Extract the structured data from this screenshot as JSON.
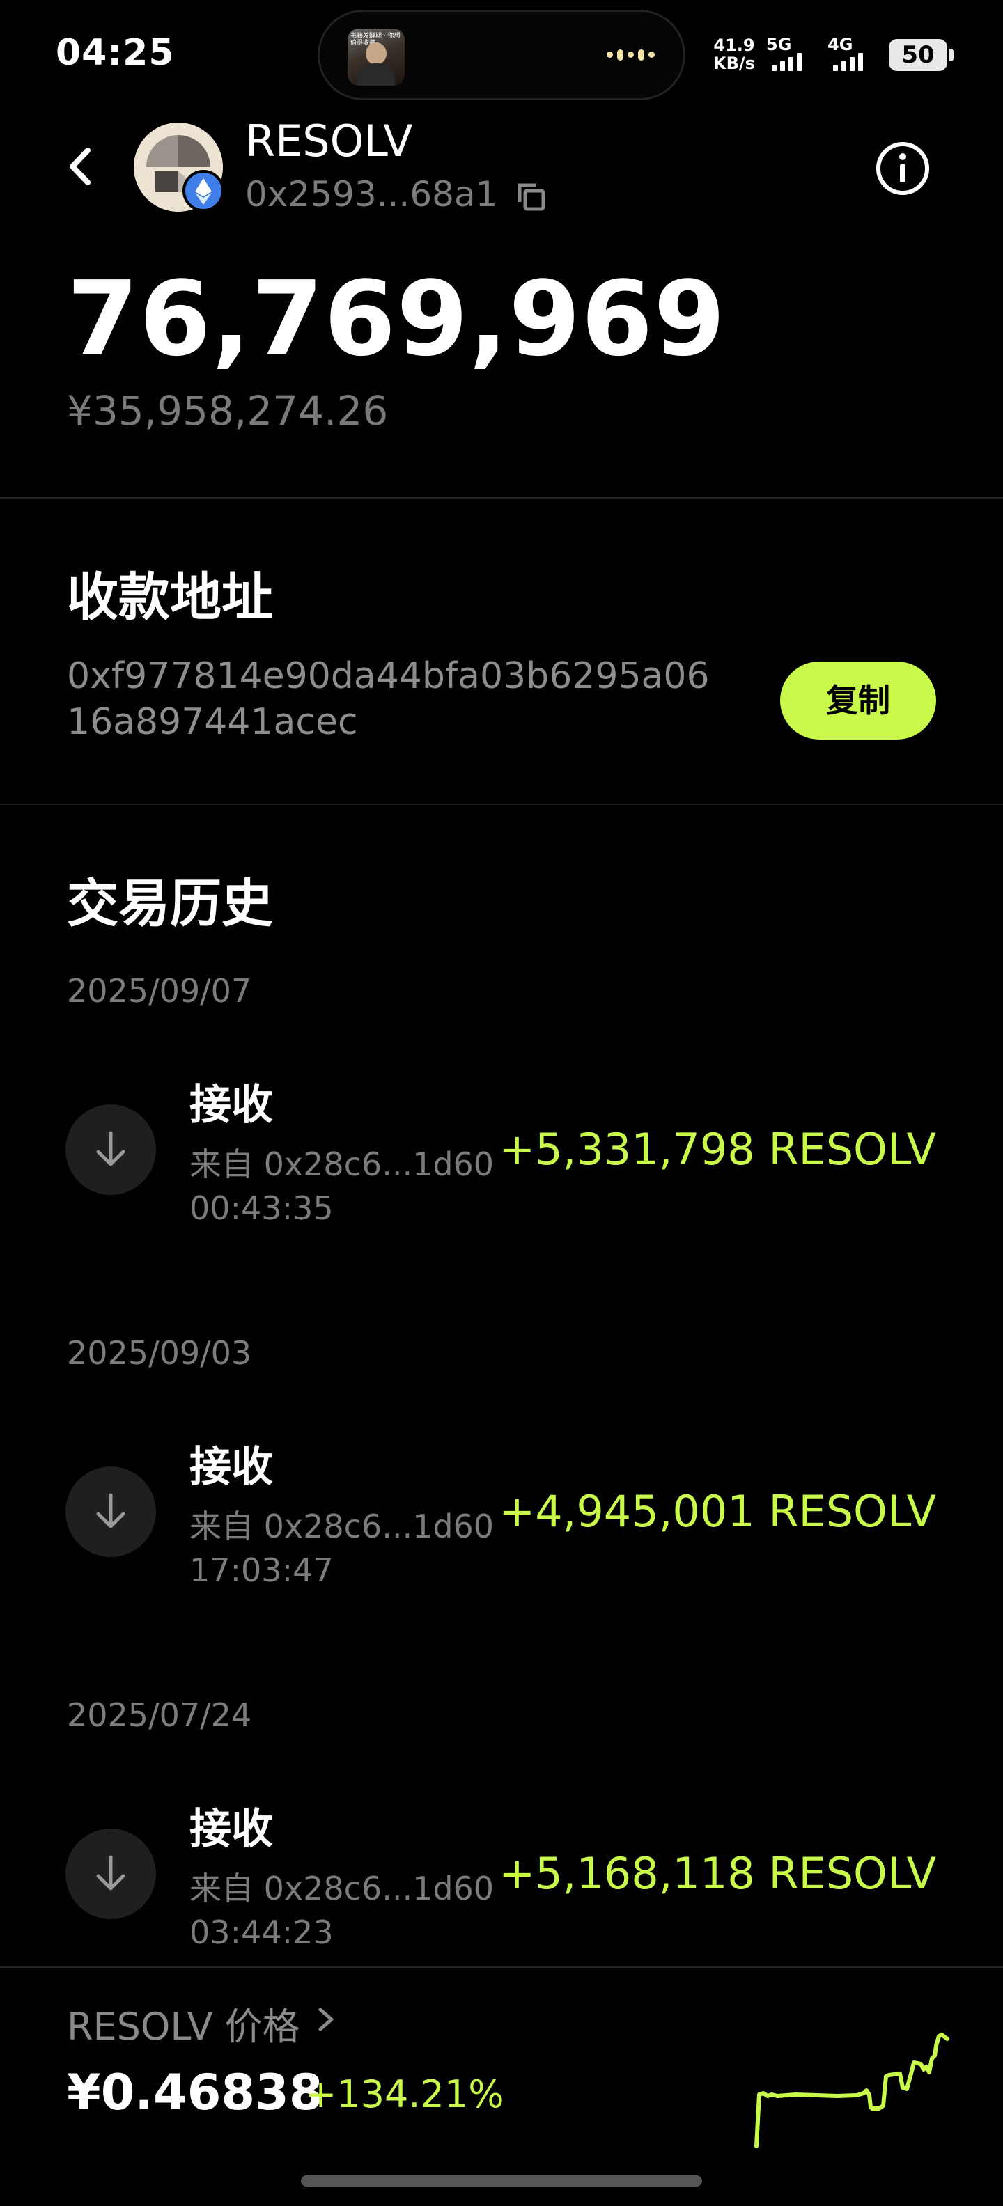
{
  "status_bar": {
    "time": "04:25",
    "net_speed_value": "41.9",
    "net_speed_unit": "KB/s",
    "signal_1_label": "5G",
    "signal_2_label": "4G",
    "battery": "50",
    "island_caption": "书籍发酵期 · 你想值得收藏"
  },
  "header": {
    "token_name": "RESOLV",
    "contract_address": "0x2593...68a1",
    "network_icon": "ethereum-icon"
  },
  "balance": {
    "amount": "76,769,969",
    "fiat_value": "¥35,958,274.26"
  },
  "receive": {
    "title": "收款地址",
    "address": "0xf977814e90da44bfa03b6295a0616a897441acec",
    "copy_label": "复制"
  },
  "history": {
    "title": "交易历史",
    "transactions": [
      {
        "date": "2025/09/07",
        "type": "接收",
        "from": "来自 0x28c6...1d60",
        "time": "00:43:35",
        "amount": "+5,331,798 RESOLV"
      },
      {
        "date": "2025/09/03",
        "type": "接收",
        "from": "来自 0x28c6...1d60",
        "time": "17:03:47",
        "amount": "+4,945,001 RESOLV"
      },
      {
        "date": "2025/07/24",
        "type": "接收",
        "from": "来自 0x28c6...1d60",
        "time": "03:44:23",
        "amount": "+5,168,118 RESOLV"
      }
    ]
  },
  "price": {
    "label": "RESOLV 价格",
    "value": "¥0.46838",
    "change": "+134.21%"
  },
  "colors": {
    "accent": "#c9f94b",
    "background": "#000000",
    "muted_text": "#7c7c7c",
    "icon_circle": "#1f1f1f",
    "eth_badge": "#3f7ee8"
  }
}
